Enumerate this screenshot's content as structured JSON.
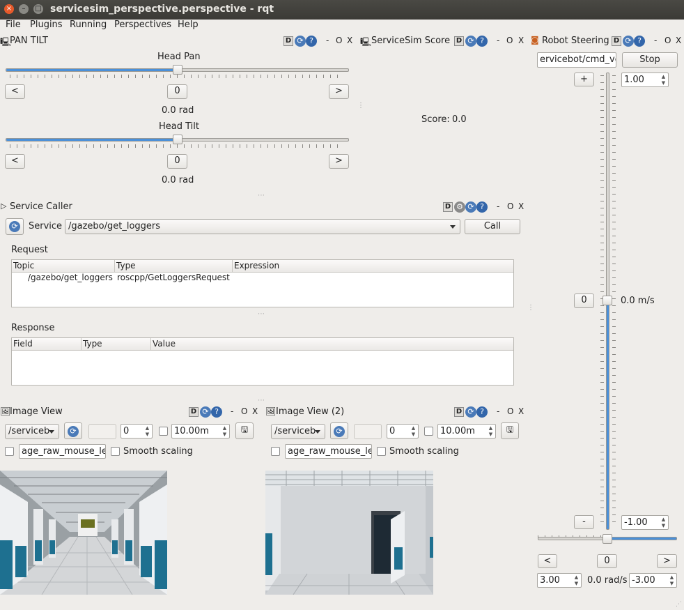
{
  "window": {
    "title": "servicesim_perspective.perspective - rqt"
  },
  "menu": {
    "file": "File",
    "plugins": "Plugins",
    "running": "Running",
    "perspectives": "Perspectives",
    "help": "Help"
  },
  "dock_controls": {
    "d": "D",
    "dash": "-",
    "o": "O",
    "x": "X"
  },
  "pan_tilt": {
    "title": "PAN TILT",
    "head_pan": {
      "label": "Head Pan",
      "value": "0",
      "unit_text": "0.0 rad",
      "slider_fraction": 0.5
    },
    "head_tilt": {
      "label": "Head Tilt",
      "value": "0",
      "unit_text": "0.0 rad",
      "slider_fraction": 0.5
    },
    "left_btn": "<",
    "right_btn": ">"
  },
  "score": {
    "title": "ServiceSim Score",
    "label": "Score:",
    "value": "0.0"
  },
  "robot_steering": {
    "title": "Robot Steering",
    "topic": "ervicebot/cmd_vel",
    "stop": "Stop",
    "plus": "+",
    "minus": "-",
    "zero": "0",
    "max_linear": "1.00",
    "min_linear": "-1.00",
    "linear_value": "0.0 m/s",
    "angular_left": "<",
    "angular_right": ">",
    "angular_zero": "0",
    "max_angular": "3.00",
    "angular_value": "0.0 rad/s",
    "min_angular": "-3.00",
    "linear_fraction": 0.5,
    "angular_fraction": 0.5
  },
  "service_caller": {
    "title": "Service Caller",
    "service_label": "Service",
    "service_value": "/gazebo/get_loggers",
    "call": "Call",
    "request_label": "Request",
    "request_headers": [
      "Topic",
      "Type",
      "Expression"
    ],
    "request_rows": [
      [
        "/gazebo/get_loggers",
        "roscpp/GetLoggersRequest",
        ""
      ]
    ],
    "response_label": "Response",
    "response_headers": [
      "Field",
      "Type",
      "Value"
    ]
  },
  "image_view_1": {
    "title": "Image View",
    "topic": "/serviceb",
    "spin_value": "0",
    "range_value": "10.00m",
    "mouse_topic": "age_raw_mouse_left",
    "smooth": "Smooth scaling"
  },
  "image_view_2": {
    "title": "Image View (2)",
    "topic": "/serviceb",
    "spin_value": "0",
    "range_value": "10.00m",
    "mouse_topic": "age_raw_mouse_left",
    "smooth": "Smooth scaling"
  },
  "colors": {
    "accent": "#4a90d9",
    "titlebar": "#3b3a36",
    "close": "#e75a2b",
    "teal": "#2a7a9a"
  }
}
